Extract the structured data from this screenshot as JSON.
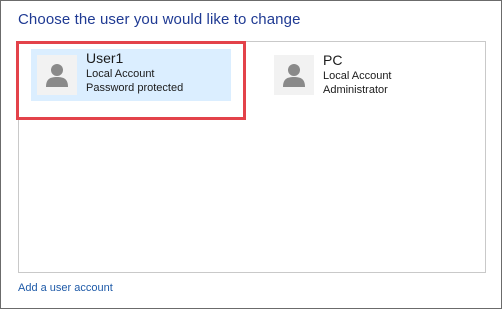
{
  "header": {
    "title": "Choose the user you would like to change"
  },
  "users": [
    {
      "name": "User1",
      "lines": [
        "Local Account",
        "Password protected"
      ],
      "selected": true,
      "icon": "user-avatar-icon"
    },
    {
      "name": "PC",
      "lines": [
        "Local Account",
        "Administrator"
      ],
      "selected": false,
      "icon": "user-avatar-icon"
    }
  ],
  "footer": {
    "add_account_label": "Add a user account"
  },
  "colors": {
    "heading": "#1f3a93",
    "selected_bg": "#dbeeff",
    "highlight_border": "#e3424a",
    "link": "#1e5aa8"
  }
}
